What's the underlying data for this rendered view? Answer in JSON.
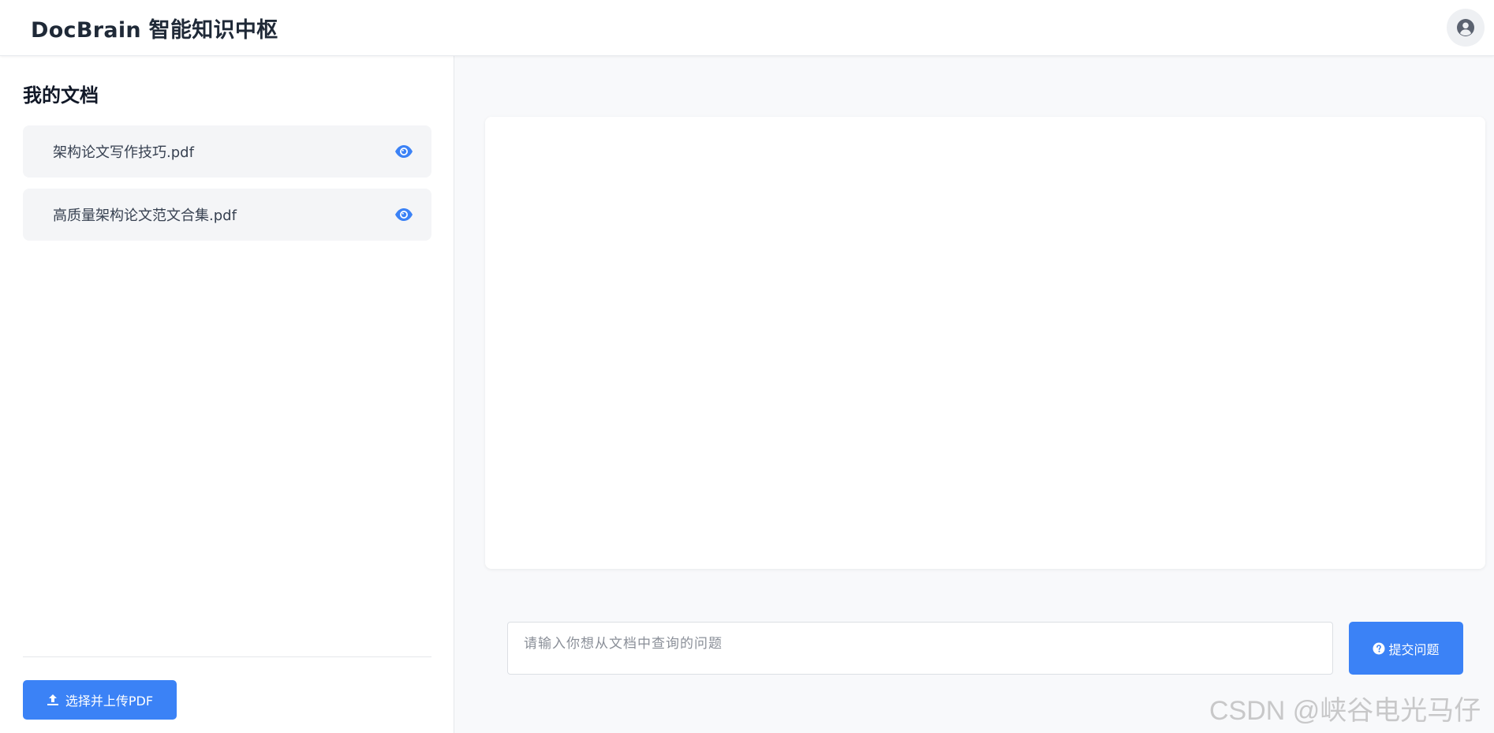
{
  "header": {
    "app_title": "DocBrain 智能知识中枢"
  },
  "sidebar": {
    "title": "我的文档",
    "documents": [
      {
        "name": "架构论文写作技巧.pdf",
        "icon": "eye-icon"
      },
      {
        "name": "高质量架构论文范文合集.pdf",
        "icon": "eye-icon"
      }
    ],
    "upload_label": "选择并上传PDF"
  },
  "query": {
    "placeholder": "请输入你想从文档中查询的问题",
    "value": "",
    "submit_label": "提交问题"
  },
  "watermark": "CSDN @峡谷电光马仔",
  "colors": {
    "accent": "#3b82f6",
    "header_bg": "#ffffff",
    "page_bg": "#f8f9fb"
  }
}
